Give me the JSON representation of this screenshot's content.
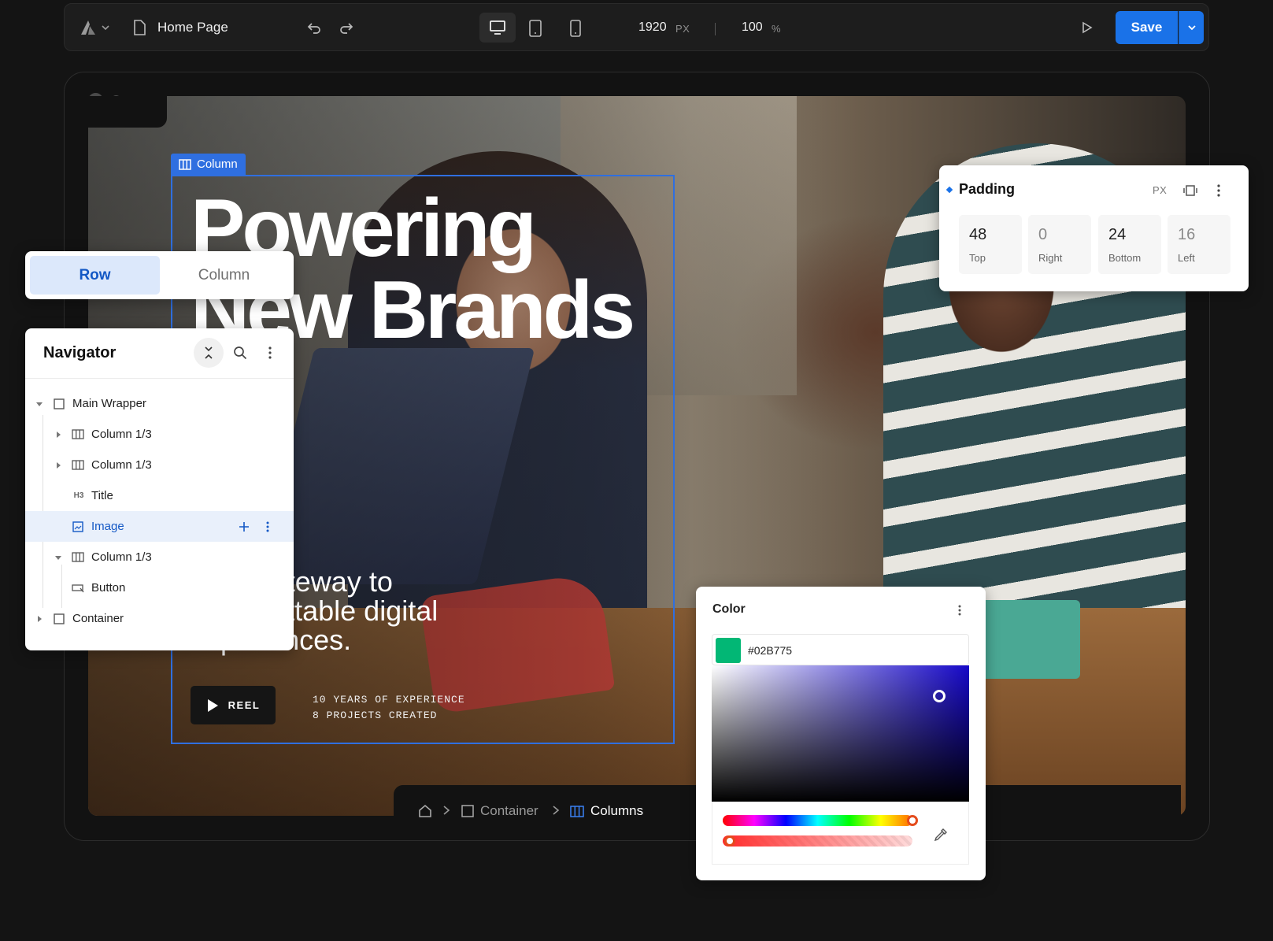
{
  "toolbar": {
    "logo_icon": "brand-logo-icon",
    "page_title": "Home Page",
    "width_value": "1920",
    "width_unit": "PX",
    "zoom_value": "100",
    "zoom_unit": "%",
    "save_label": "Save",
    "accent": "#1a72e8"
  },
  "hero": {
    "column_tag": "Column",
    "headline_line1": "Powering",
    "headline_line2": "New Brands",
    "subline": "Your gateway to unforgettable digital experiences.",
    "reel_label": "REEL",
    "stat_1": "10 YEARS OF EXPERIENCE",
    "stat_2": "8 PROJECTS CREATED"
  },
  "layout_toggle": {
    "options": [
      "Row",
      "Column"
    ],
    "selected": "Row"
  },
  "navigator": {
    "title": "Navigator",
    "items": [
      {
        "label": "Main Wrapper",
        "icon": "container-icon",
        "expanded": true
      },
      {
        "label": "Column 1/3",
        "icon": "columns-icon",
        "expanded": false
      },
      {
        "label": "Column 1/3",
        "icon": "columns-icon",
        "expanded": false
      },
      {
        "label": "Title",
        "icon": "h3-icon"
      },
      {
        "label": "Image",
        "icon": "image-icon",
        "selected": true
      },
      {
        "label": "Column 1/3",
        "icon": "columns-icon",
        "expanded": true
      },
      {
        "label": "Button",
        "icon": "button-icon"
      },
      {
        "label": "Container",
        "icon": "container-icon",
        "expanded": false
      }
    ]
  },
  "padding": {
    "title": "Padding",
    "unit": "PX",
    "values": [
      {
        "value": "48",
        "label": "Top"
      },
      {
        "value": "0",
        "label": "Right"
      },
      {
        "value": "24",
        "label": "Bottom"
      },
      {
        "value": "16",
        "label": "Left"
      }
    ]
  },
  "color_panel": {
    "title": "Color",
    "hex": "#02B775",
    "swatch_color": "#02B775"
  },
  "breadcrumb": {
    "items": [
      "Container",
      "Columns"
    ],
    "active": "Columns"
  }
}
